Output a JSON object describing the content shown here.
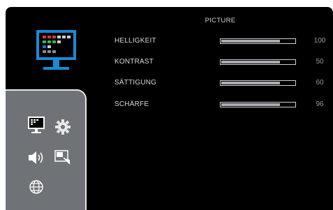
{
  "osd": {
    "title": "PICTURE",
    "rows": [
      {
        "label": "HELLIGKEIT",
        "value": "100",
        "level": 0.8
      },
      {
        "label": "KONTRAST",
        "value": "50",
        "level": 0.8
      },
      {
        "label": "SÄTTIGUNG",
        "value": "60",
        "level": 0.8
      },
      {
        "label": "SCHÄRFE",
        "value": "96",
        "level": 0.8
      }
    ]
  },
  "sidebar": {
    "items": [
      {
        "icon": "picture-icon"
      },
      {
        "icon": "gear-icon"
      },
      {
        "icon": "speaker-icon"
      },
      {
        "icon": "resize-window-icon"
      },
      {
        "icon": "globe-icon"
      }
    ]
  },
  "colors": {
    "background": "#000000",
    "panel": "#6f7276",
    "accent_blue": "#1a8ad4",
    "bar_fill": "#a9adb2"
  }
}
